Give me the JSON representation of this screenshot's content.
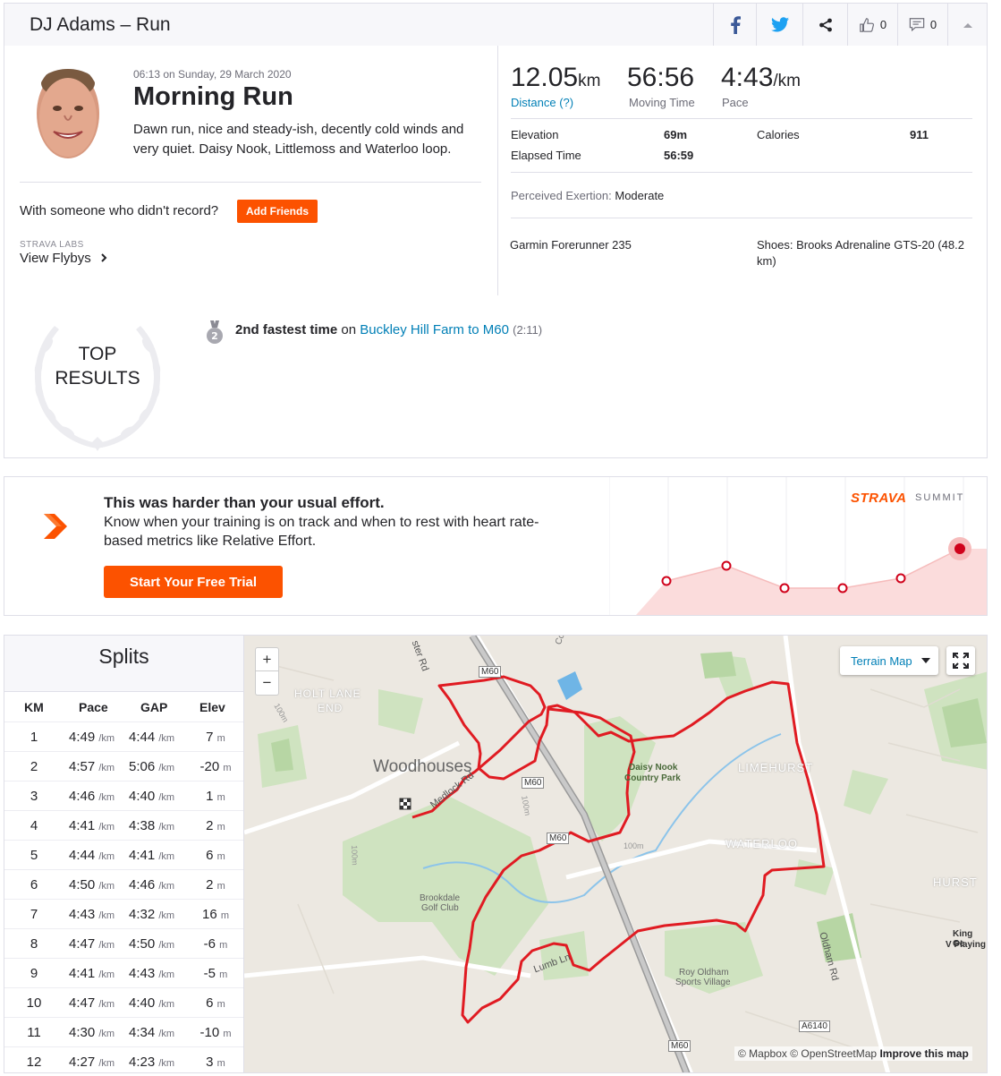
{
  "header": {
    "title": "DJ Adams – Run",
    "kudos_count": "0",
    "comment_count": "0"
  },
  "activity": {
    "timestamp": "06:13 on Sunday, 29 March 2020",
    "name": "Morning Run",
    "description": "Dawn run, nice and steady-ish, decently cold winds and very quiet. Daisy Nook, Littlemoss and Waterloo loop.",
    "with_someone": "With someone who didn't record?",
    "add_friends": "Add Friends",
    "labs_label": "STRAVA LABS",
    "flybys_label": "View Flybys"
  },
  "stats": {
    "distance": "12.05",
    "distance_unit": "km",
    "distance_label": "Distance (?)",
    "moving_time": "56:56",
    "moving_time_label": "Moving Time",
    "pace": "4:43",
    "pace_unit": "/km",
    "pace_label": "Pace",
    "elevation_label": "Elevation",
    "elevation": "69m",
    "calories_label": "Calories",
    "calories": "911",
    "elapsed_label": "Elapsed Time",
    "elapsed": "56:59",
    "exertion_label": "Perceived Exertion:",
    "exertion": "Moderate",
    "device": "Garmin Forerunner 235",
    "shoes": "Shoes: Brooks Adrenaline GTS-20 (48.2 km)"
  },
  "top_results": {
    "line1": "TOP",
    "line2": "RESULTS",
    "medal": "2",
    "achievement": "2nd fastest time",
    "on": "on",
    "segment": "Buckley Hill Farm to M60",
    "time": "(2:11)"
  },
  "summit": {
    "heading": "This was harder than your usual effort.",
    "body": "Know when your training is on track and when to rest with heart rate-based metrics like Relative Effort.",
    "cta": "Start Your Free Trial",
    "logo": "STRAVA",
    "logo_suffix": "SUMMIT"
  },
  "splits": {
    "title": "Splits",
    "columns": [
      "KM",
      "Pace",
      "GAP",
      "Elev"
    ],
    "pace_unit": "/km",
    "elev_unit": "m",
    "rows": [
      {
        "km": "1",
        "pace": "4:49",
        "gap": "4:44",
        "elev": "7"
      },
      {
        "km": "2",
        "pace": "4:57",
        "gap": "5:06",
        "elev": "-20"
      },
      {
        "km": "3",
        "pace": "4:46",
        "gap": "4:40",
        "elev": "1"
      },
      {
        "km": "4",
        "pace": "4:41",
        "gap": "4:38",
        "elev": "2"
      },
      {
        "km": "5",
        "pace": "4:44",
        "gap": "4:41",
        "elev": "6"
      },
      {
        "km": "6",
        "pace": "4:50",
        "gap": "4:46",
        "elev": "2"
      },
      {
        "km": "7",
        "pace": "4:43",
        "gap": "4:32",
        "elev": "16"
      },
      {
        "km": "8",
        "pace": "4:47",
        "gap": "4:50",
        "elev": "-6"
      },
      {
        "km": "9",
        "pace": "4:41",
        "gap": "4:43",
        "elev": "-5"
      },
      {
        "km": "10",
        "pace": "4:47",
        "gap": "4:40",
        "elev": "6"
      },
      {
        "km": "11",
        "pace": "4:30",
        "gap": "4:34",
        "elev": "-10"
      },
      {
        "km": "12",
        "pace": "4:27",
        "gap": "4:23",
        "elev": "3"
      }
    ]
  },
  "map": {
    "zoom_in": "+",
    "zoom_out": "−",
    "style_select": "Terrain Map",
    "attribution_prefix": "© Mapbox © OpenStreetMap",
    "improve_link": "Improve this map",
    "labels": {
      "woodhouses": "Woodhouses",
      "holt_lane_1": "HOLT LANE",
      "holt_lane_2": "END",
      "daisy_nook_1": "Daisy Nook",
      "daisy_nook_2": "Country Park",
      "limehurst": "LIMEHURST",
      "waterloo": "WATERLOO",
      "hurst": "HURST",
      "brookdale_1": "Brookdale",
      "brookdale_2": "Golf Club",
      "roy_oldham_1": "Roy Oldham",
      "roy_oldham_2": "Sports Village",
      "king_1": "King Ge",
      "king_2": "V Playing",
      "m60_a": "M60",
      "m60_b": "M60",
      "m60_c": "M60",
      "m60_d": "M60",
      "a6140": "A6140",
      "oldham_rd": "Oldham Rd",
      "medlock_rd": "Medlock Rd",
      "lumb_ln": "Lumb Ln",
      "ster_rd": "ster Rd",
      "contour_100a": "100m",
      "contour_100b": "100m",
      "contour_100c": "100m",
      "contour_100d": "100m",
      "coal": "Coal"
    }
  },
  "colors": {
    "brand_orange": "#fc5200",
    "link_blue": "#007fb6",
    "route_red": "#e01b22"
  },
  "icons": [
    "facebook-icon",
    "twitter-icon",
    "share-icon",
    "thumbs-up-icon",
    "comment-icon",
    "chevron-up-icon",
    "chevron-right-icon",
    "medal-icon",
    "summit-chevron-icon",
    "expand-icon",
    "caret-down-icon"
  ]
}
